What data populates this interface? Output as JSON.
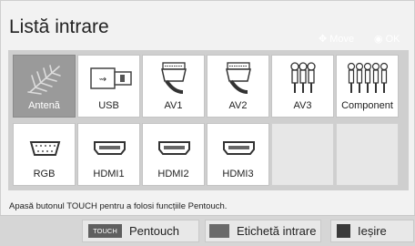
{
  "window": {
    "title": "Listă intrare"
  },
  "hints": {
    "move": "Move",
    "ok": "OK"
  },
  "inputs": [
    {
      "label": "Antenă",
      "icon": "antenna-icon",
      "selected": true
    },
    {
      "label": "USB",
      "icon": "usb-icon"
    },
    {
      "label": "AV1",
      "icon": "scart-icon"
    },
    {
      "label": "AV2",
      "icon": "scart-icon"
    },
    {
      "label": "AV3",
      "icon": "rca-av-icon"
    },
    {
      "label": "Component",
      "icon": "component-icon"
    },
    {
      "label": "RGB",
      "icon": "vga-icon"
    },
    {
      "label": "HDMI1",
      "icon": "hdmi-icon"
    },
    {
      "label": "HDMI2",
      "icon": "hdmi-icon"
    },
    {
      "label": "HDMI3",
      "icon": "hdmi-icon"
    }
  ],
  "message": "Apasă butonul TOUCH pentru a folosi funcțiile Pentouch.",
  "buttons": {
    "pentouch": {
      "key": "TOUCH",
      "label": "Pentouch"
    },
    "input_label": {
      "label": "Etichetă intrare"
    },
    "exit": {
      "label": "Ieșire"
    }
  },
  "colors": {
    "selected_tile": "#9a9a9a",
    "panel": "#cfcfcf",
    "tile": "#ffffff"
  }
}
